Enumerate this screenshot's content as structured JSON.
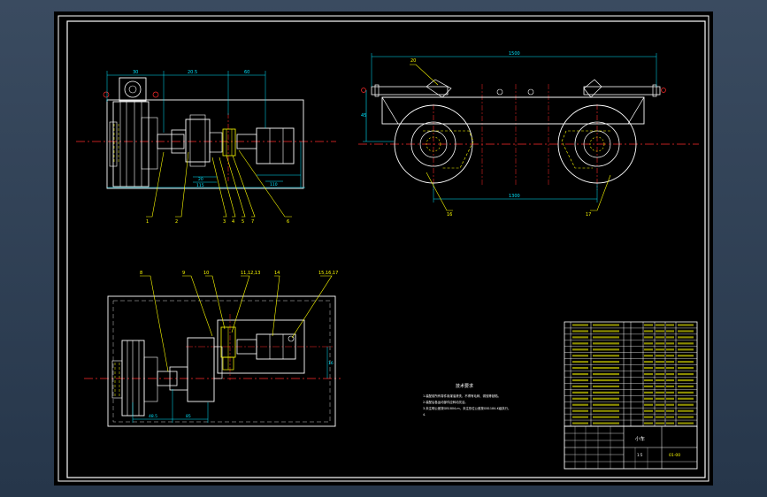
{
  "drawing": {
    "colors": {
      "background": "#000000",
      "outline": "#ffffff",
      "dimension": "#00e5ff",
      "centerline": "#ff2a2a",
      "leader": "#ffff00",
      "hidden": "#ffff00"
    },
    "top_view_dims": [
      "30",
      "20.5",
      "60",
      "20",
      "115",
      "110"
    ],
    "top_view_balloons": [
      "1",
      "2",
      "3",
      "4",
      "5",
      "7",
      "6"
    ],
    "side_view_dims": {
      "overall": "1500",
      "bottom": "1300",
      "height": "45"
    },
    "side_view_balloons": [
      "20",
      "16",
      "17"
    ],
    "plan_view_dims": [
      "48.5",
      "85",
      "16"
    ],
    "plan_view_balloons": [
      "8",
      "9",
      "10",
      "11,12,13",
      "14",
      "15,16,17"
    ],
    "notes": {
      "title": "技术要求",
      "lines": [
        "1.装配前所有零件用煤油清洗，不得有毛刺、锈蚀等缺陷。",
        "2.装配后各运动部件应转动灵活。",
        "3.未注明公差按GB1804-m，未注形位公差按GB1184-K级执行。",
        "4."
      ]
    },
    "title_block": {
      "name": "小车",
      "drawing_no": "01-00",
      "scale_label": "1:5"
    }
  }
}
